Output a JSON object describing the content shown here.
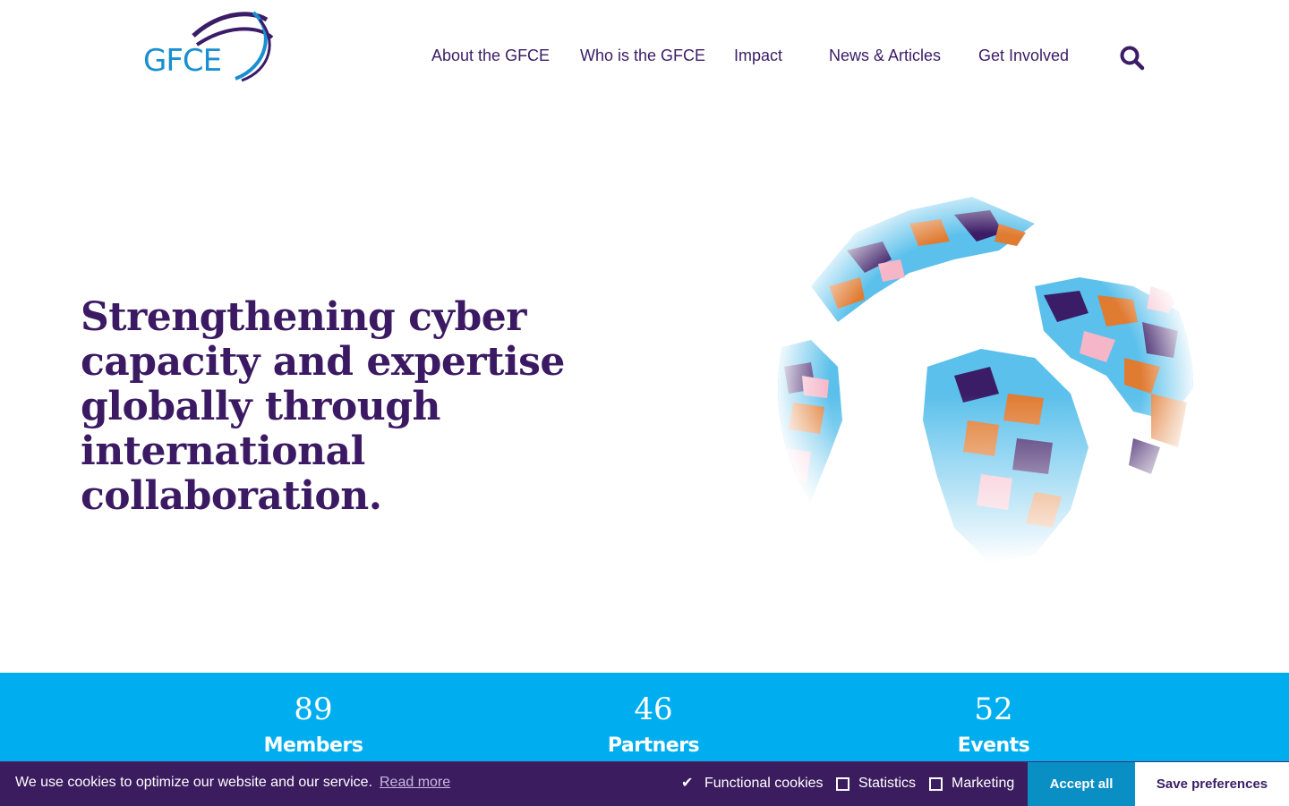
{
  "header": {
    "logo_text": "GFCE",
    "nav": [
      {
        "label": "About the GFCE"
      },
      {
        "label": "Who is the GFCE"
      },
      {
        "label": "Impact"
      },
      {
        "label": "News & Articles"
      },
      {
        "label": "Get Involved"
      }
    ],
    "search_icon": "search-icon"
  },
  "hero": {
    "title_lines": [
      "Strengthening cyber",
      "capacity and expertise",
      "globally through",
      "international collaboration."
    ],
    "image": "globe-illustration"
  },
  "stats": [
    {
      "value": "89",
      "label": "Members"
    },
    {
      "value": "46",
      "label": "Partners"
    },
    {
      "value": "52",
      "label": "Events"
    }
  ],
  "cookie_bar": {
    "message": "We use cookies to optimize our website and our service.",
    "read_more": "Read more",
    "options": [
      {
        "label": "Functional cookies",
        "checked": true
      },
      {
        "label": "Statistics",
        "checked": false
      },
      {
        "label": "Marketing",
        "checked": false
      }
    ],
    "accept_label": "Accept all",
    "save_label": "Save preferences"
  },
  "colors": {
    "brand_purple": "#3b1a63",
    "brand_blue": "#00aeef",
    "logo_blue": "#1a8fd0",
    "cookie_bg": "#3b1c5f",
    "accept_bg": "#0a8fc4",
    "globe_orange": "#e07b32",
    "globe_pink": "#f5b6c8",
    "globe_lightblue": "#5bc0eb"
  }
}
